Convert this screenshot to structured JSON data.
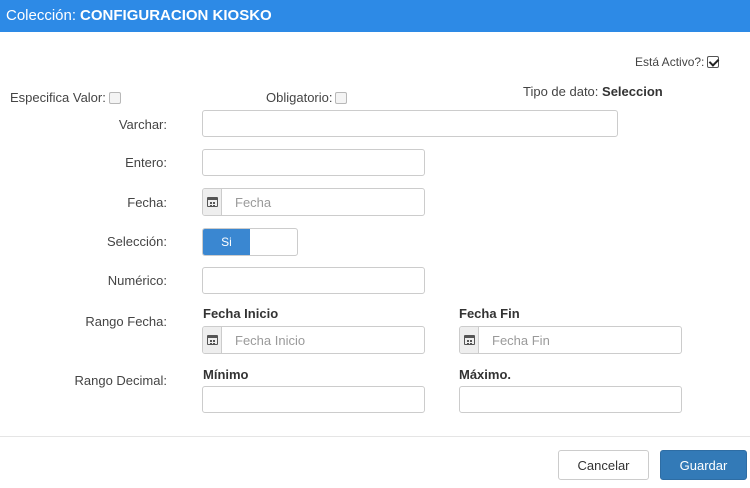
{
  "header": {
    "prefix": "Colección:",
    "name": "CONFIGURACION KIOSKO"
  },
  "status": {
    "active_label": "Está Activo?:",
    "active_checked": true
  },
  "flags": {
    "especifica_label": "Especifica Valor:",
    "obligatorio_label": "Obligatorio:",
    "tipo_label": "Tipo de dato:",
    "tipo_value": "Seleccion"
  },
  "fields": {
    "varchar_label": "Varchar:",
    "entero_label": "Entero:",
    "fecha_label": "Fecha:",
    "fecha_placeholder": "Fecha",
    "seleccion_label": "Selección:",
    "seleccion_toggle": "Si",
    "numerico_label": "Numérico:",
    "rango_fecha_label": "Rango Fecha:",
    "fecha_inicio_head": "Fecha Inicio",
    "fecha_inicio_placeholder": "Fecha Inicio",
    "fecha_fin_head": "Fecha Fin",
    "fecha_fin_placeholder": "Fecha Fin",
    "rango_decimal_label": "Rango Decimal:",
    "minimo_head": "Mínimo",
    "maximo_head": "Máximo."
  },
  "footer": {
    "cancel_label": "Cancelar",
    "save_label": "Guardar"
  },
  "colors": {
    "header_bg": "#2d8ae6",
    "primary": "#337ab7",
    "toggle_on": "#3a87d1"
  }
}
